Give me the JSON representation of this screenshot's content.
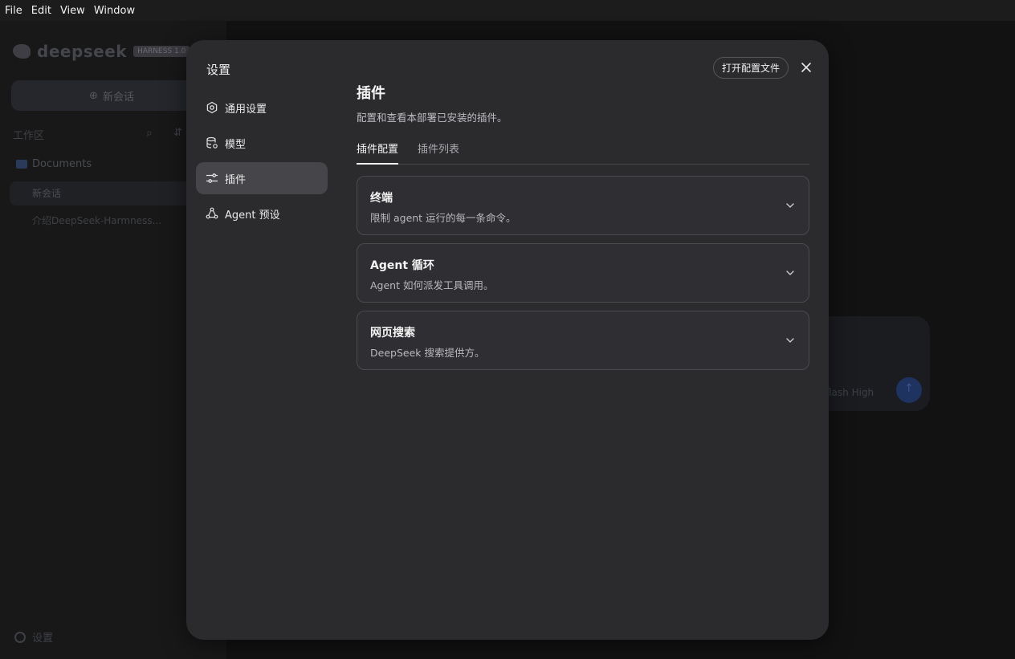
{
  "menubar": [
    "File",
    "Edit",
    "View",
    "Window"
  ],
  "background": {
    "logo_text": "deepseek",
    "logo_badge": "HARNESS 1.0",
    "new_chat": "新会话",
    "workspace_label": "工作区",
    "folder": "Documents",
    "active_item": "新会话",
    "item_2": "介绍DeepSeek-Harmness...",
    "settings": "设置",
    "model_selector": "flash High"
  },
  "modal": {
    "title": "设置",
    "open_config": "打开配置文件",
    "nav": [
      {
        "label": "通用设置",
        "icon": "gear-icon"
      },
      {
        "label": "模型",
        "icon": "database-icon"
      },
      {
        "label": "插件",
        "icon": "sliders-icon"
      },
      {
        "label": "Agent 预设",
        "icon": "agent-icon"
      }
    ],
    "active_nav": "插件",
    "section_title": "插件",
    "section_desc": "配置和查看本部署已安装的插件。",
    "tabs": [
      "插件配置",
      "插件列表"
    ],
    "active_tab": "插件配置",
    "cards": [
      {
        "title": "终端",
        "desc": "限制 agent 运行的每一条命令。"
      },
      {
        "title": "Agent 循环",
        "desc": "Agent 如何派发工具调用。"
      },
      {
        "title": "网页搜索",
        "desc": "DeepSeek 搜索提供方。"
      }
    ]
  }
}
